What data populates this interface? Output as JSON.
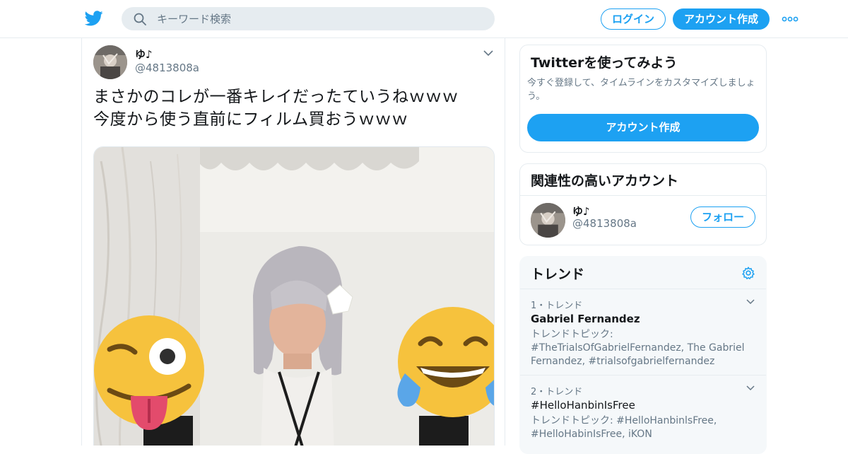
{
  "header": {
    "logo_icon": "twitter-bird-icon",
    "search_icon": "search-icon",
    "search_placeholder": "キーワード検索",
    "login_label": "ログイン",
    "signup_label": "アカウント作成",
    "more_icon": "more-dots-icon",
    "accent_color": "#1da1f2"
  },
  "tweet": {
    "author_name": "ゆ♪",
    "author_handle": "@4813808a",
    "text_lines": [
      "まさかのコレが一番キレイだったていうねｗｗｗ",
      "今度から使う直前にフィルム買おうｗｗｗ"
    ],
    "caret_icon": "chevron-down-icon",
    "media_icon": "photo"
  },
  "sidebar": {
    "signup_card": {
      "title": "Twitterを使ってみよう",
      "description": "今すぐ登録して、タイムラインをカスタマイズしましょう。",
      "button_label": "アカウント作成"
    },
    "related_card": {
      "title": "関連性の高いアカウント",
      "accounts": [
        {
          "name": "ゆ♪",
          "handle": "@4813808a",
          "follow_label": "フォロー"
        }
      ]
    },
    "trends_card": {
      "title": "トレンド",
      "settings_icon": "gear-icon",
      "items": [
        {
          "meta": "1・トレンド",
          "name": "Gabriel Fernandez",
          "description": "トレンドトピック: #TheTrialsOfGabrielFernandez, The Gabriel Fernandez, #trialsofgabrielfernandez"
        },
        {
          "meta": "2・トレンド",
          "name": "#HelloHanbinIsFree",
          "description": "トレンドトピック: #HelloHanbinlsFree, #HelloHabinIsFree, iKON"
        }
      ]
    }
  }
}
